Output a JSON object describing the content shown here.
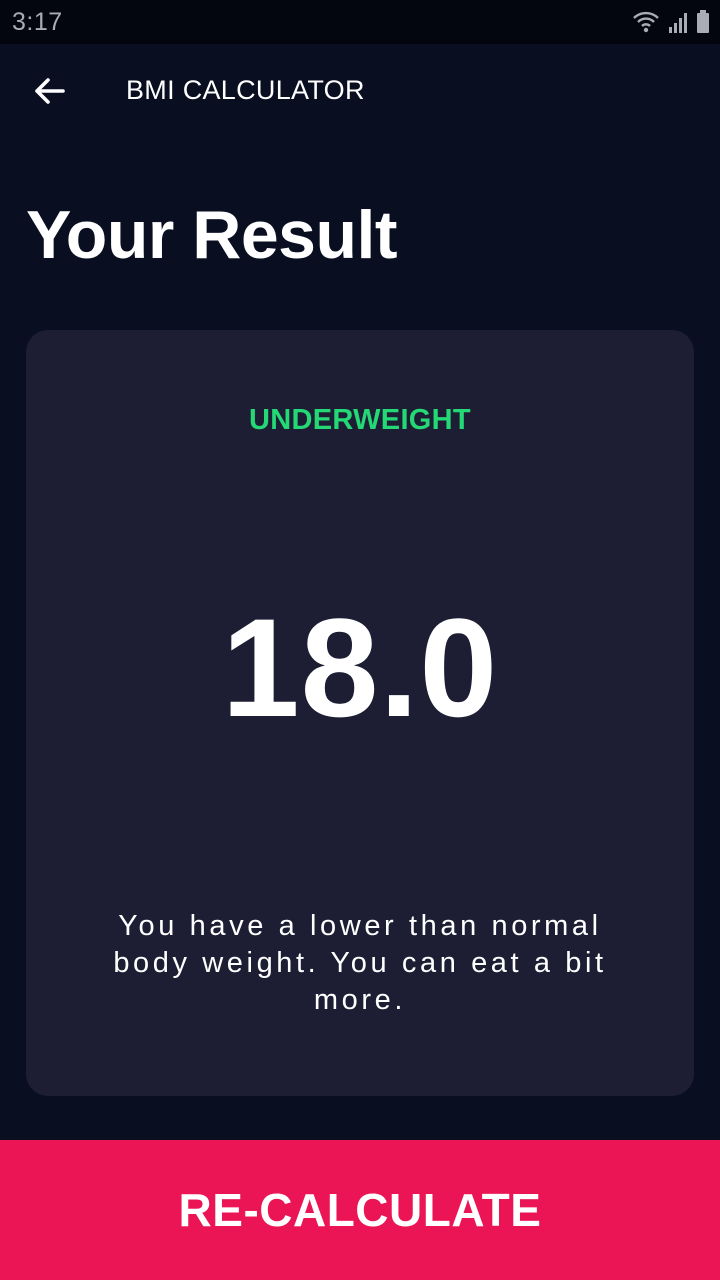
{
  "status_bar": {
    "time": "3:17",
    "icons": [
      "wifi-icon",
      "signal-icon",
      "battery-icon"
    ]
  },
  "app_bar": {
    "back_icon": "arrow-back-icon",
    "title": "BMI CALCULATOR"
  },
  "page": {
    "title": "Your Result"
  },
  "result": {
    "category": "UNDERWEIGHT",
    "bmi_value": "18.0",
    "message": "You have a lower than normal body weight. You can eat a bit more."
  },
  "actions": {
    "recalculate_label": "RE-CALCULATE"
  },
  "colors": {
    "background": "#090e21",
    "card": "#1d1e33",
    "category": "#24d876",
    "accent": "#eb1555"
  }
}
